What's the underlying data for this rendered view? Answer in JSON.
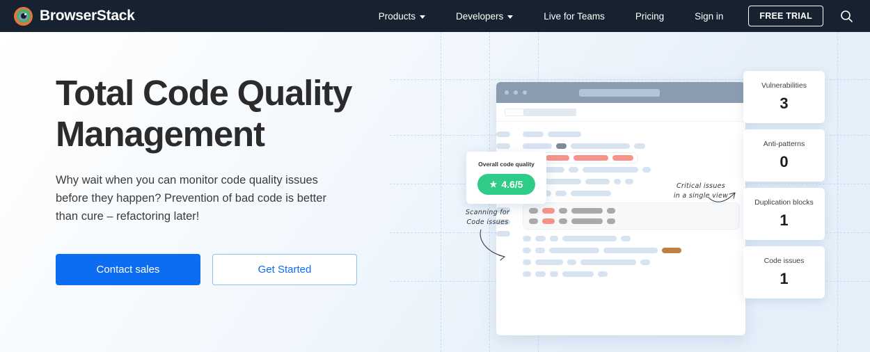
{
  "navbar": {
    "brand": "BrowserStack",
    "logo_icon": "browserstack-eye-logo",
    "links": [
      {
        "label": "Products",
        "has_caret": true
      },
      {
        "label": "Developers",
        "has_caret": true
      },
      {
        "label": "Live for Teams",
        "has_caret": false
      },
      {
        "label": "Pricing",
        "has_caret": false
      },
      {
        "label": "Sign in",
        "has_caret": false
      }
    ],
    "free_trial_label": "FREE TRIAL",
    "search_icon": "search-icon",
    "background_color": "#16222f"
  },
  "hero": {
    "headline": "Total Code Quality Management",
    "subcopy": "Why wait when you can monitor code quality issues before they happen? Prevention of bad code is better than cure – refactoring later!",
    "primary_cta": "Contact sales",
    "secondary_cta": "Get Started",
    "primary_color": "#0c6cf2"
  },
  "quality_badge": {
    "label": "Overall code quality",
    "star_icon": "star-icon",
    "score": "4.6/5",
    "pill_color": "#2ecc87"
  },
  "metrics": [
    {
      "label": "Vulnerabilities",
      "value": "3"
    },
    {
      "label": "Anti-patterns",
      "value": "0"
    },
    {
      "label": "Duplication blocks",
      "value": "1"
    },
    {
      "label": "Code issues",
      "value": "1"
    }
  ],
  "annotations": [
    {
      "line1": "Scanning for",
      "line2": "Code issues"
    },
    {
      "line1": "Critical issues",
      "line2": "in a single view"
    }
  ],
  "browser_mock": {
    "titlebar_color": "#8c9cb0",
    "dots": 3,
    "skeleton_colors": {
      "default": "#d7e3f1",
      "dark": "#7e8b9b",
      "red": "#f8938a",
      "gray": "#a9a9a9",
      "brown": "#bd8042"
    }
  }
}
